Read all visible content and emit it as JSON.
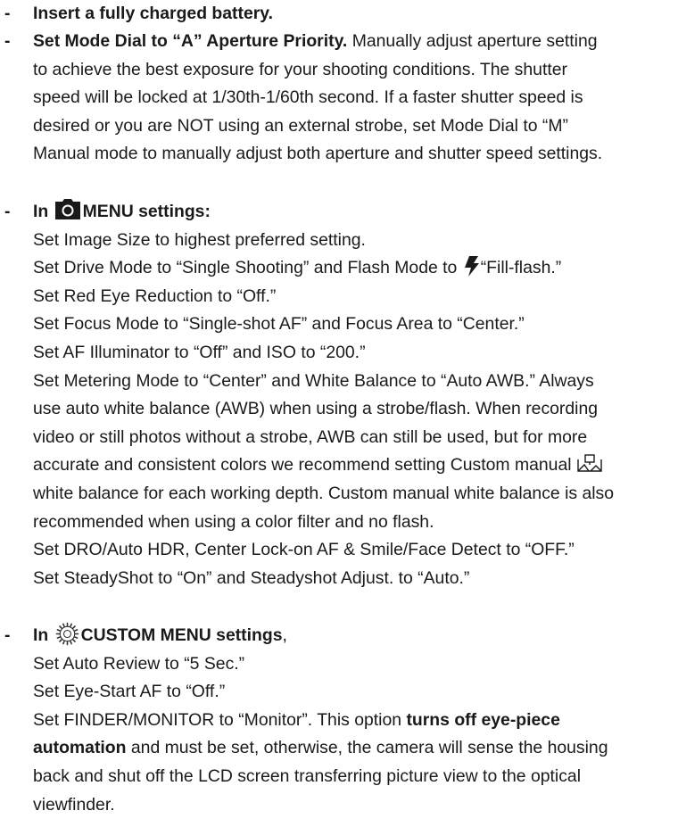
{
  "dash": "-",
  "item1": {
    "bold": "Insert a fully charged battery."
  },
  "item2": {
    "bold": "Set Mode Dial to “A” Aperture Priority.",
    "rest_first": " Manually adjust aperture setting",
    "lines": [
      "to achieve the best exposure for your shooting conditions. The shutter",
      "speed will be locked at 1/30th-1/60th second. If a faster shutter speed is",
      "desired or you are NOT using an external strobe, set Mode Dial to “M”",
      "Manual mode to manually adjust both aperture and shutter speed settings."
    ]
  },
  "item3": {
    "heading_pre": "In ",
    "heading_post": "MENU settings:",
    "icon": "camera-icon",
    "line1": "Set Image Size to highest preferred setting.",
    "line2_pre": "Set Drive Mode to “Single Shooting” and Flash Mode to ",
    "line2_icon": "flash-icon",
    "line2_post": "“Fill-flash.”",
    "line3": "Set Red Eye Reduction to “Off.”",
    "line4": "Set Focus Mode to “Single-shot AF” and Focus Area to “Center.”",
    "line5": "Set AF Illuminator to “Off” and ISO to “200.”",
    "line6": "Set Metering Mode to “Center” and White Balance to “Auto AWB.” Always",
    "line7": "use auto white balance (AWB) when using a strobe/flash. When recording",
    "line8": "video or still photos without a strobe, AWB can still be used, but for more",
    "line9_pre": "accurate and consistent colors we recommend setting Custom manual",
    "line9_icon": "custom-white-balance-icon",
    "line10": "white balance for each working depth. Custom manual white balance is also",
    "line11": "recommended when using a color filter and no flash.",
    "line12": "Set DRO/Auto HDR, Center Lock-on AF & Smile/Face Detect to “OFF.”",
    "line13": "Set SteadyShot to “On” and Steadyshot Adjust. to “Auto.”"
  },
  "item4": {
    "heading_pre": "In ",
    "heading_icon": "custom-gear-icon",
    "heading_bold": "CUSTOM MENU settings",
    "heading_post": ",",
    "line1": "Set Auto Review to “5 Sec.”",
    "line2": "Set Eye-Start AF to “Off.”",
    "line3_pre": "Set FINDER/MONITOR to “Monitor”. This option ",
    "line3_bold": "turns off eye-piece",
    "line4_bold": "automation",
    "line4_post": " and must be set, otherwise, the camera will sense the housing",
    "line5": "back and shut off the LCD screen transferring picture view to the optical",
    "line6": "viewfinder."
  }
}
